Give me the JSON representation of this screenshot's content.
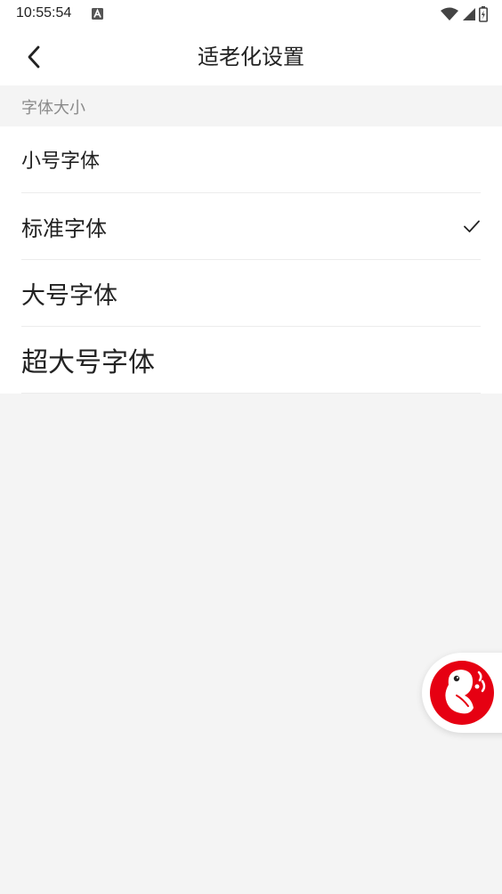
{
  "status_bar": {
    "time": "10:55:54",
    "icons": [
      "a-notification-icon",
      "wifi-icon",
      "signal-icon",
      "battery-icon"
    ]
  },
  "header": {
    "title": "适老化设置",
    "back_icon": "chevron-left-icon"
  },
  "section": {
    "title": "字体大小"
  },
  "options": [
    {
      "label": "小号字体",
      "selected": false
    },
    {
      "label": "标准字体",
      "selected": true
    },
    {
      "label": "大号字体",
      "selected": false
    },
    {
      "label": "超大号字体",
      "selected": false
    }
  ],
  "floating_widget": {
    "icon": "mascot-icon",
    "accent_color": "#e60012"
  },
  "colors": {
    "background": "#f4f4f4",
    "surface": "#ffffff",
    "text_primary": "#222222",
    "text_secondary": "#8a8a8a",
    "divider": "#ececec"
  }
}
